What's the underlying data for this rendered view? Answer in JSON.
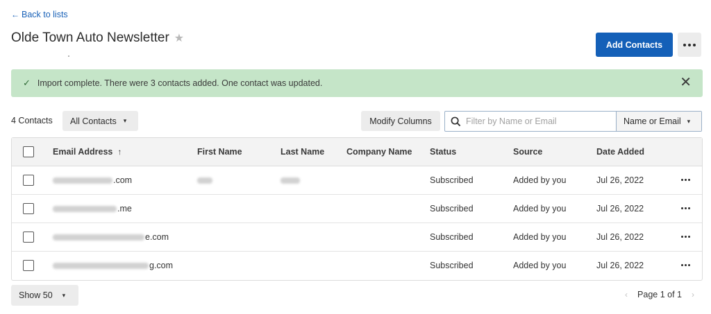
{
  "nav": {
    "back_label": "Back to lists"
  },
  "header": {
    "title": "Olde Town Auto Newsletter",
    "add_label": "Add Contacts"
  },
  "alert": {
    "message": "Import complete. There were 3 contacts added. One contact was updated."
  },
  "toolbar": {
    "count_label": "4 Contacts",
    "filter_value": "All Contacts",
    "modify_label": "Modify Columns",
    "search_placeholder": "Filter by Name or Email",
    "search_scope": "Name or Email"
  },
  "table": {
    "columns": [
      "Email Address",
      "First Name",
      "Last Name",
      "Company Name",
      "Status",
      "Source",
      "Date Added"
    ],
    "rows": [
      {
        "email_suffix": ".com",
        "status": "Subscribed",
        "source": "Added by you",
        "date": "Jul 26, 2022"
      },
      {
        "email_suffix": ".me",
        "status": "Subscribed",
        "source": "Added by you",
        "date": "Jul 26, 2022"
      },
      {
        "email_suffix": "e.com",
        "status": "Subscribed",
        "source": "Added by you",
        "date": "Jul 26, 2022"
      },
      {
        "email_suffix": "g.com",
        "status": "Subscribed",
        "source": "Added by you",
        "date": "Jul 26, 2022"
      }
    ]
  },
  "footer": {
    "page_size": "Show 50",
    "page_label": "Page 1 of 1"
  },
  "colors": {
    "accent": "#1460b8",
    "link": "#1a62b8",
    "success_bg": "#c5e5c8"
  }
}
